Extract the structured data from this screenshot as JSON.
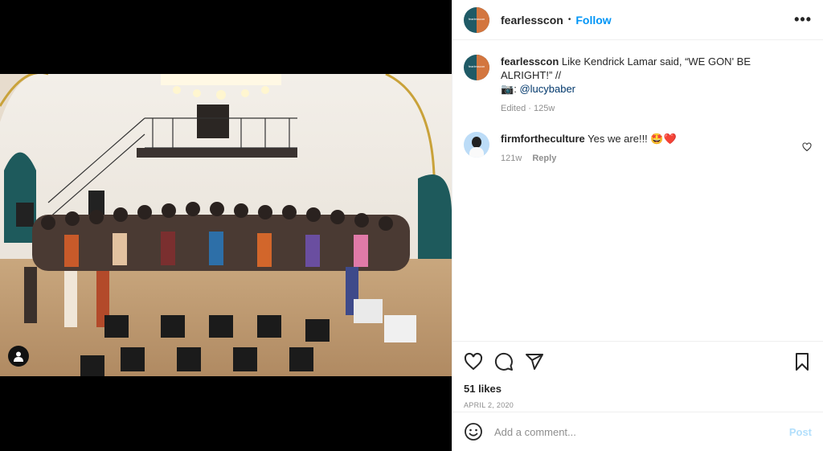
{
  "post": {
    "username": "fearlesscon",
    "avatar_text": "fearlesscon",
    "follow_label": "Follow",
    "separator": "•",
    "more_label": "•••"
  },
  "caption": {
    "username": "fearlesscon",
    "text": "Like Kendrick Lamar said, “WE GON' BE ALRIGHT!” //",
    "camera_emoji": "📷",
    "colon": ":",
    "mention": "@lucybaber",
    "meta": "Edited · 125w"
  },
  "comments": [
    {
      "username": "firmfortheculture",
      "text": "Yes we are!!! ",
      "emojis": "🤩❤️",
      "time": "121w",
      "reply_label": "Reply"
    }
  ],
  "actions": {
    "likes": "51 likes",
    "date": "APRIL 2, 2020"
  },
  "add_comment": {
    "placeholder": "Add a comment...",
    "post_label": "Post"
  },
  "colors": {
    "link": "#0095f6",
    "mention": "#00376b",
    "post_disabled": "#b2dffc",
    "muted": "#8e8e8e"
  },
  "icons": [
    "tag-user-icon",
    "more-options-icon",
    "heart-icon",
    "comment-icon",
    "share-icon",
    "bookmark-icon",
    "emoji-icon",
    "like-comment-icon"
  ]
}
